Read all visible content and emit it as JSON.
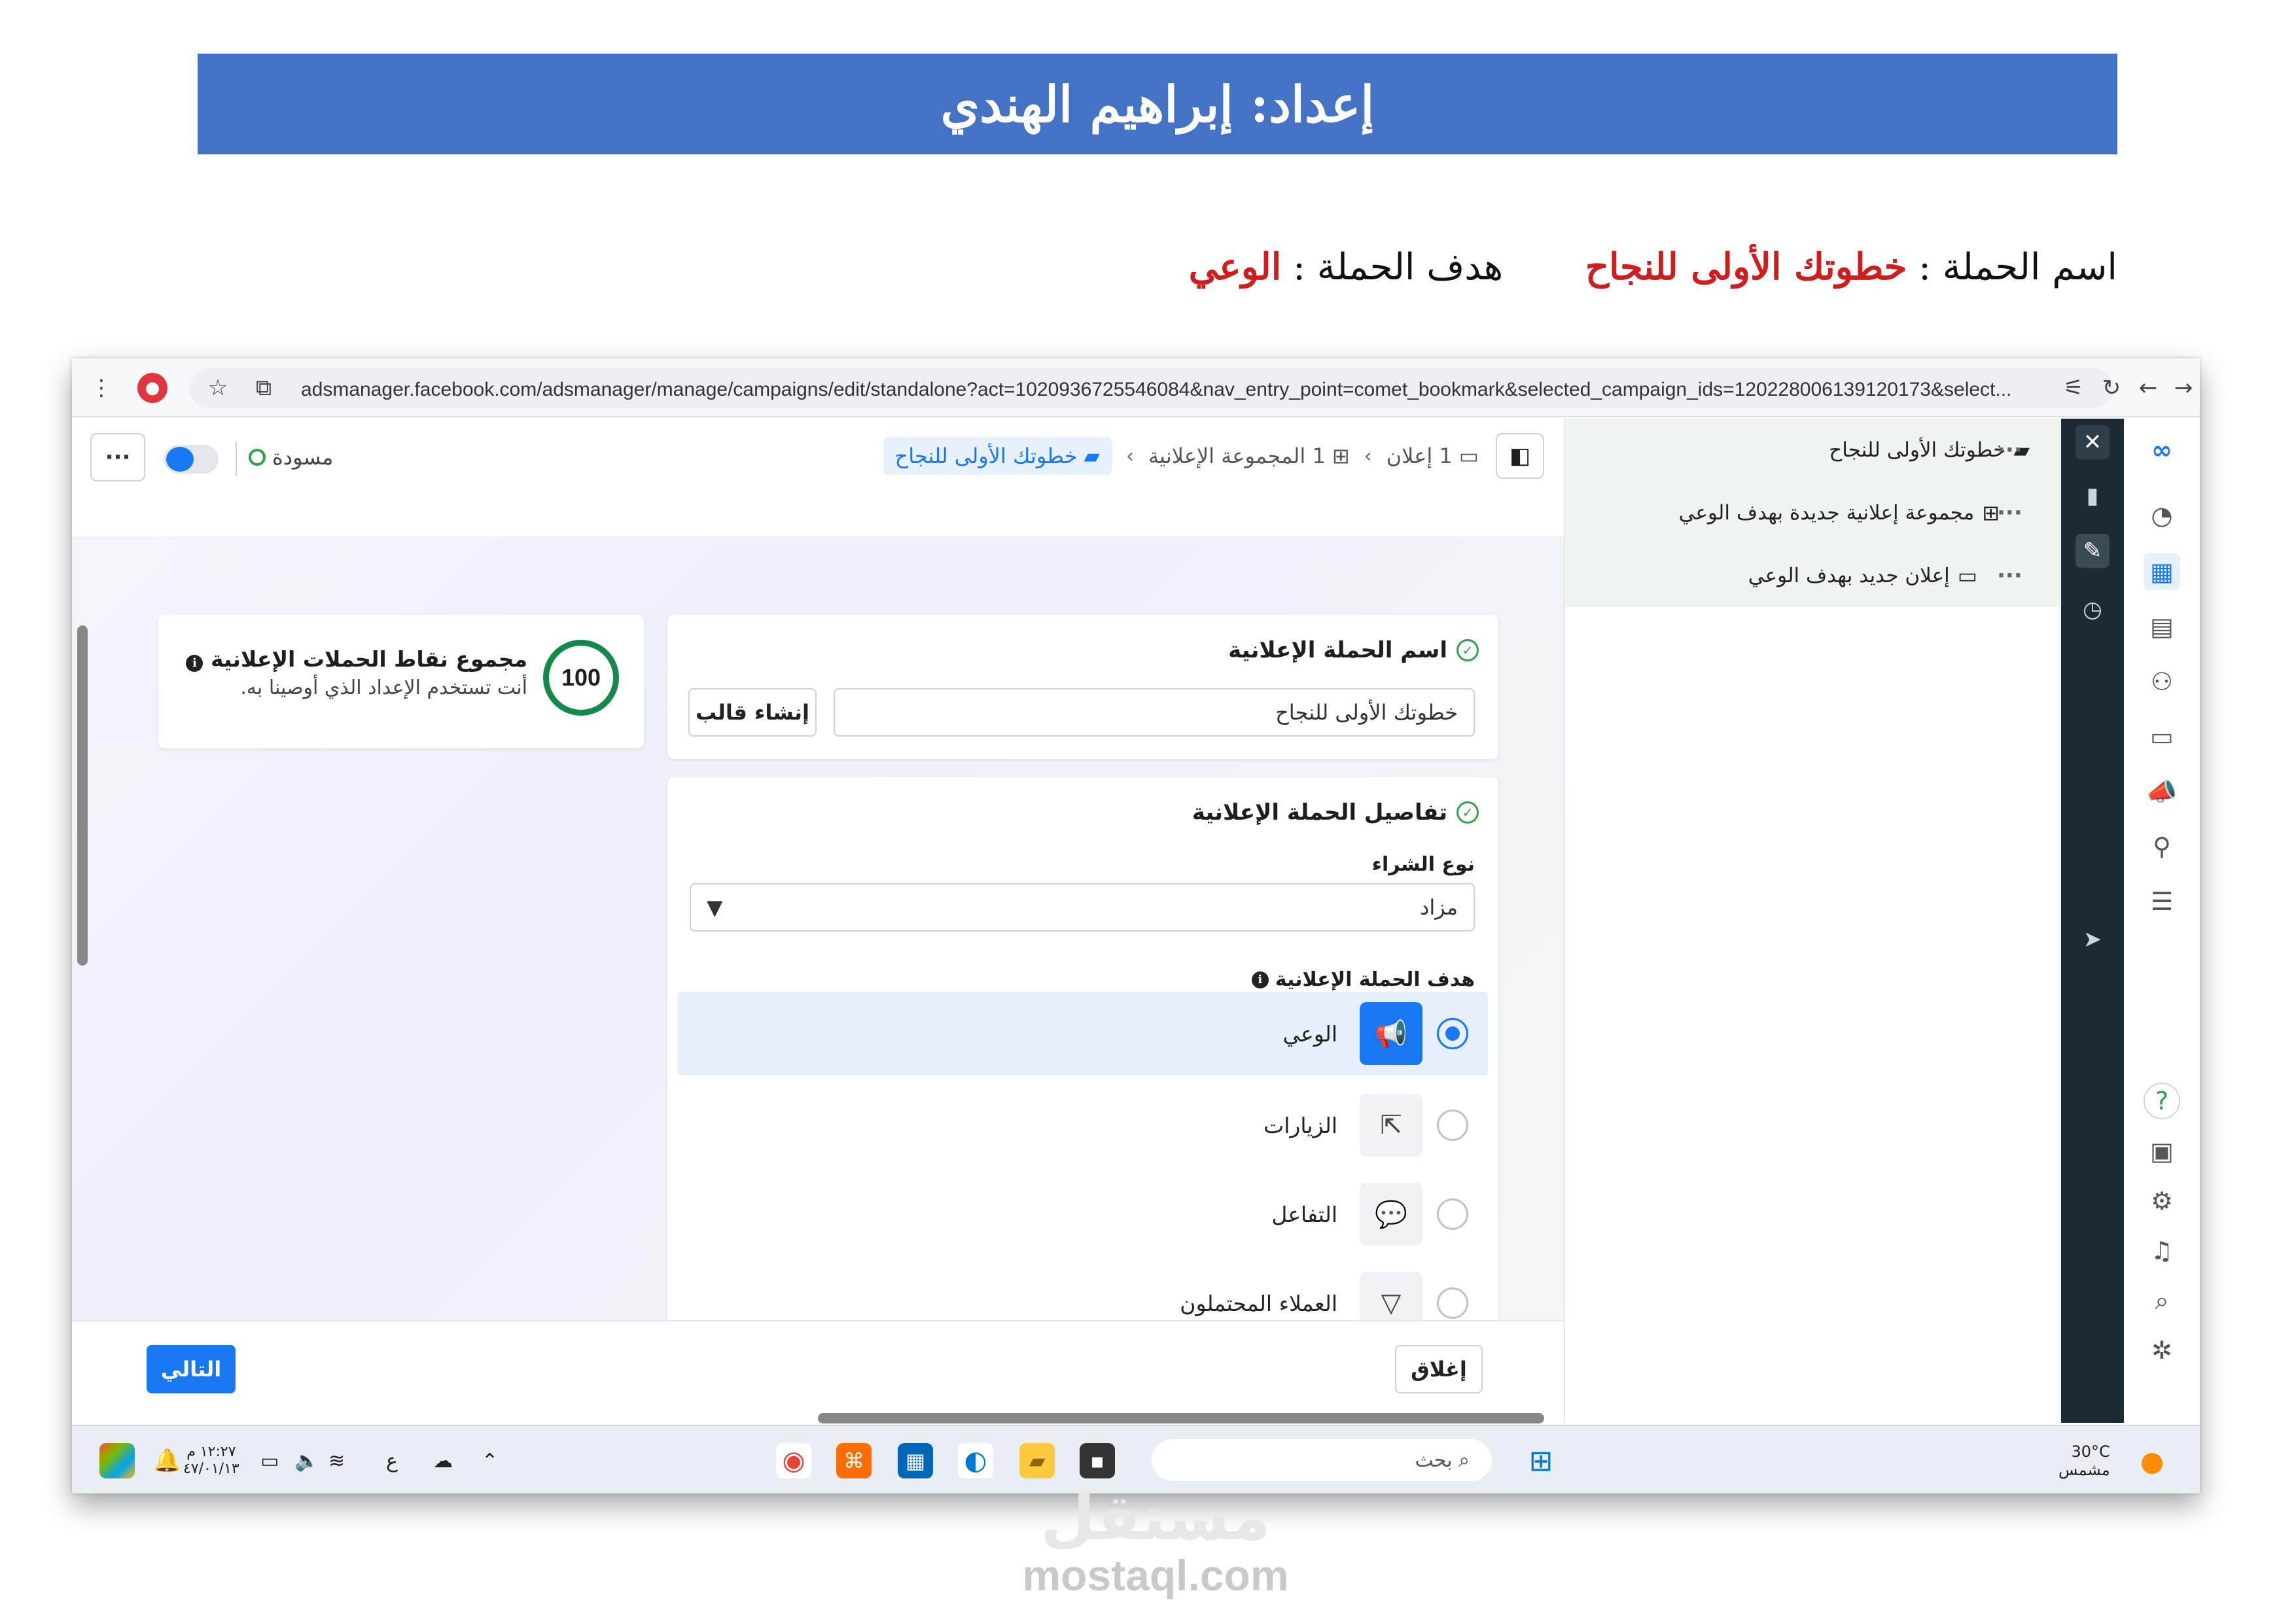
{
  "banner": {
    "title": "إعداد: إبراهيم الهندي"
  },
  "campaign_info": {
    "name_label": "اسم الحملة :",
    "name_value": "خطوتك الأولى للنجاح",
    "goal_label": "هدف الحملة :",
    "goal_value": "الوعي"
  },
  "browser": {
    "url": "adsmanager.facebook.com/adsmanager/manage/campaigns/edit/standalone?act=1020936725546084&nav_entry_point=comet_bookmark&selected_campaign_ids=120228006139120173&select..."
  },
  "toolbar": {
    "more_label": "···",
    "status": "مسودة",
    "breadcrumb": {
      "campaign": "خطوتك الأولى للنجاح",
      "adset": "1 المجموعة الإعلانية",
      "ad": "1 إعلان"
    }
  },
  "score": {
    "value": "100",
    "title": "مجموع نقاط الحملات الإعلانية",
    "subtitle": "أنت تستخدم الإعداد الذي أوصينا به."
  },
  "name_section": {
    "title": "اسم الحملة الإعلانية",
    "input_value": "خطوتك الأولى للنجاح",
    "template_button": "إنشاء قالب"
  },
  "details_section": {
    "title": "تفاصيل الحملة الإعلانية",
    "buy_type_label": "نوع الشراء",
    "buy_type_value": "مزاد",
    "objective_label": "هدف الحملة الإعلانية",
    "objectives": [
      {
        "label": "الوعي",
        "icon": "megaphone-icon",
        "selected": true
      },
      {
        "label": "الزيارات",
        "icon": "cursor-icon",
        "selected": false
      },
      {
        "label": "التفاعل",
        "icon": "chat-icon",
        "selected": false
      },
      {
        "label": "العملاء المحتملون",
        "icon": "funnel-icon",
        "selected": false
      }
    ]
  },
  "footer": {
    "next_button": "التالي",
    "close_button": "إغلاق"
  },
  "tree": {
    "campaign": "خطوتك الأولى للنجاح",
    "adset": "مجموعة إعلانية جديدة بهدف الوعي",
    "ad": "إعلان جديد بهدف الوعي",
    "dots": "···"
  },
  "taskbar": {
    "weather_temp": "30°C",
    "weather_desc": "مشمس",
    "search_placeholder": "بحث",
    "lang": "ع",
    "time": "١٢:٢٧ م",
    "date": "٤٧/٠١/١٣"
  },
  "watermark": {
    "logo_text": "مستقل",
    "site": "mostaql.com"
  },
  "colors": {
    "banner": "#4472c4",
    "highlight_red": "#d01c1c",
    "brand_blue": "#1877f2",
    "dark_rail": "#1c2b33",
    "success_green": "#31a24c"
  }
}
